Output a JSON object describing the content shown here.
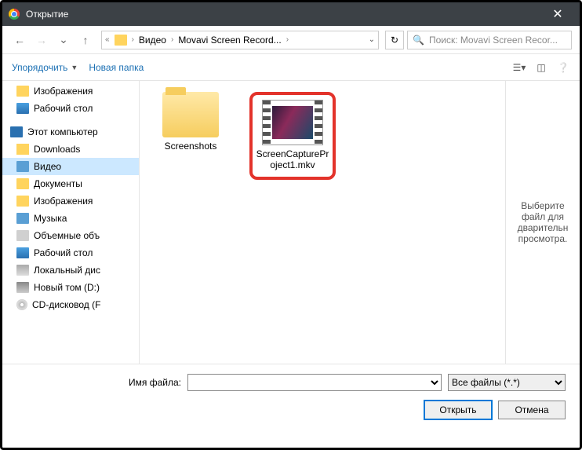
{
  "window": {
    "title": "Открытие",
    "close": "✕"
  },
  "nav": {
    "back": "←",
    "forward": "→",
    "recent": "⌄",
    "up": "↑",
    "crumbs": {
      "c1": "Видео",
      "c2": "Movavi Screen Record..."
    },
    "refresh": "↻",
    "search_placeholder": "Поиск: Movavi Screen Recor..."
  },
  "toolbar": {
    "organize": "Упорядочить",
    "newfolder": "Новая папка"
  },
  "tree": {
    "images": "Изображения",
    "desktop": "Рабочий стол",
    "pc": "Этот компьютер",
    "downloads": "Downloads",
    "video": "Видео",
    "docs": "Документы",
    "images2": "Изображения",
    "music": "Музыка",
    "volumes": "Объемные объ",
    "desktop2": "Рабочий стол",
    "local": "Локальный дис",
    "newtom": "Новый том (D:)",
    "cd": "CD-дисковод (F"
  },
  "files": {
    "folder1": "Screenshots",
    "video1": "ScreenCapturePr\noject1.mkv",
    "video1_a": "ScreenCapturePr",
    "video1_b": "oject1.mkv"
  },
  "preview": {
    "text": "Выберите файл для дварительн просмотра."
  },
  "footer": {
    "label": "Имя файла:",
    "filter": "Все файлы (*.*)",
    "open": "Открыть",
    "cancel": "Отмена"
  }
}
